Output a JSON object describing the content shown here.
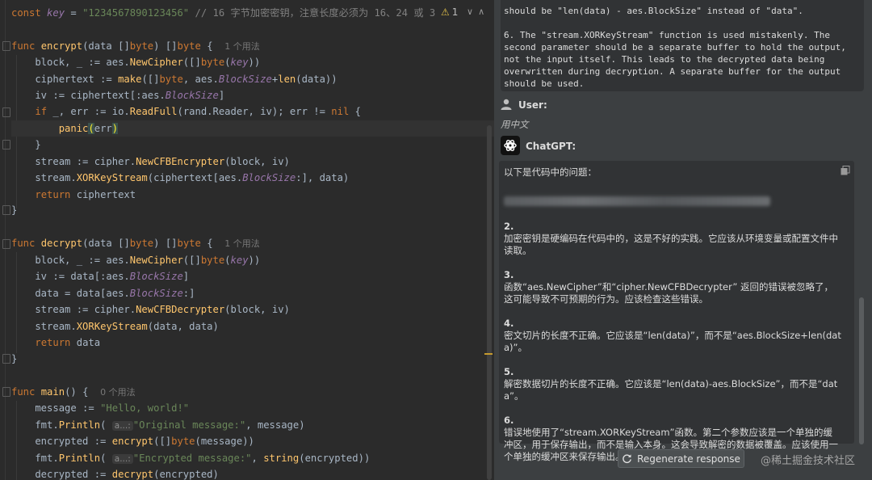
{
  "editor": {
    "top_line": {
      "kw": "const",
      "name": "key",
      "eq": " = ",
      "value": "\"1234567890123456\"",
      "comment": "// 16 字节加密密钥，注意长度必须为 16、24 或 3"
    },
    "warnings": {
      "symbol": "⚠",
      "count": "1"
    },
    "usage_hint_1": "1 个用法",
    "usage_hint_0": "0 个用法",
    "inlay_a": "a...:"
  },
  "chat": {
    "prev_tail": "should be \"len(data) - aes.BlockSize\" instead of \"data\".",
    "prev_item_6": "6. The \"stream.XORKeyStream\" function is used mistakenly. The second parameter should be a separate buffer to hold the output, not the input itself. This leads to the decrypted data being overwritten during decryption. A separate buffer for the output should be used.",
    "user_label": "User:",
    "user_message": "用中文",
    "assistant_label": "ChatGPT:",
    "answer_intro": "以下是代码中的问题：",
    "answer_items": [
      {
        "num": "2.",
        "text": "加密密钥是硬编码在代码中的，这是不好的实践。它应该从环境变量或配置文件中读取。"
      },
      {
        "num": "3.",
        "text": "函数“aes.NewCipher”和“cipher.NewCFBDecrypter” 返回的错误被忽略了，这可能导致不可预期的行为。应该检查这些错误。"
      },
      {
        "num": "4.",
        "text": "密文切片的长度不正确。它应该是“len(data)”，而不是“aes.BlockSize+len(data)”。"
      },
      {
        "num": "5.",
        "text": "解密数据切片的长度不正确。它应该是“len(data)-aes.BlockSize”，而不是“data”。"
      },
      {
        "num": "6.",
        "text": "错误地使用了“stream.XORKeyStream”函数。第二个参数应该是一个单独的缓冲区，用于保存输出，而不是输入本身。这会导致解密的数据被覆盖。应该使用一个单独的缓冲区来保存输出。"
      }
    ],
    "regenerate_label": "Regenerate response",
    "watermark": "@稀土掘金技术社区"
  },
  "colors": {
    "keyword": "#cc7832",
    "function": "#ffc66d",
    "string": "#6a8759",
    "field": "#9876aa",
    "comment": "#808080",
    "text": "#a9b7c6"
  }
}
